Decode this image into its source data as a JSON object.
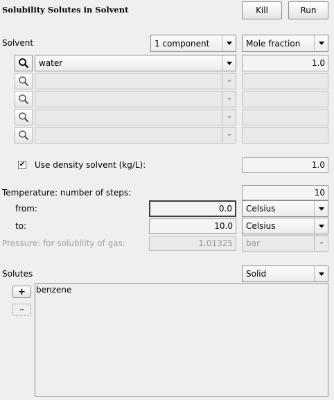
{
  "title": "Solubility Solutes in Solvent",
  "toolbar": {
    "kill_label": "Kill",
    "run_label": "Run"
  },
  "solvent": {
    "label": "Solvent",
    "components_select": "1 component",
    "unit_select": "Mole fraction",
    "rows": [
      {
        "name": "water",
        "value": "1.0",
        "enabled": true
      },
      {
        "name": "",
        "value": "",
        "enabled": false
      },
      {
        "name": "",
        "value": "",
        "enabled": false
      },
      {
        "name": "",
        "value": "",
        "enabled": false
      },
      {
        "name": "",
        "value": "",
        "enabled": false
      }
    ],
    "density_check": "✔",
    "density_label": "Use density solvent (kg/L):",
    "density_value": "1.0"
  },
  "temperature": {
    "steps_label": "Temperature: number of steps:",
    "steps_value": "10",
    "from_label": "from:",
    "from_value": "0.0",
    "from_unit": "Celsius",
    "to_label": "to:",
    "to_value": "10.0",
    "to_unit": "Celsius"
  },
  "pressure": {
    "label": "Pressure: for solubility of gas:",
    "value": "1.01325",
    "unit": "bar"
  },
  "solutes": {
    "label": "Solutes",
    "phase_select": "Solid",
    "add_label": "+",
    "remove_label": "--",
    "items": [
      "benzene"
    ]
  }
}
